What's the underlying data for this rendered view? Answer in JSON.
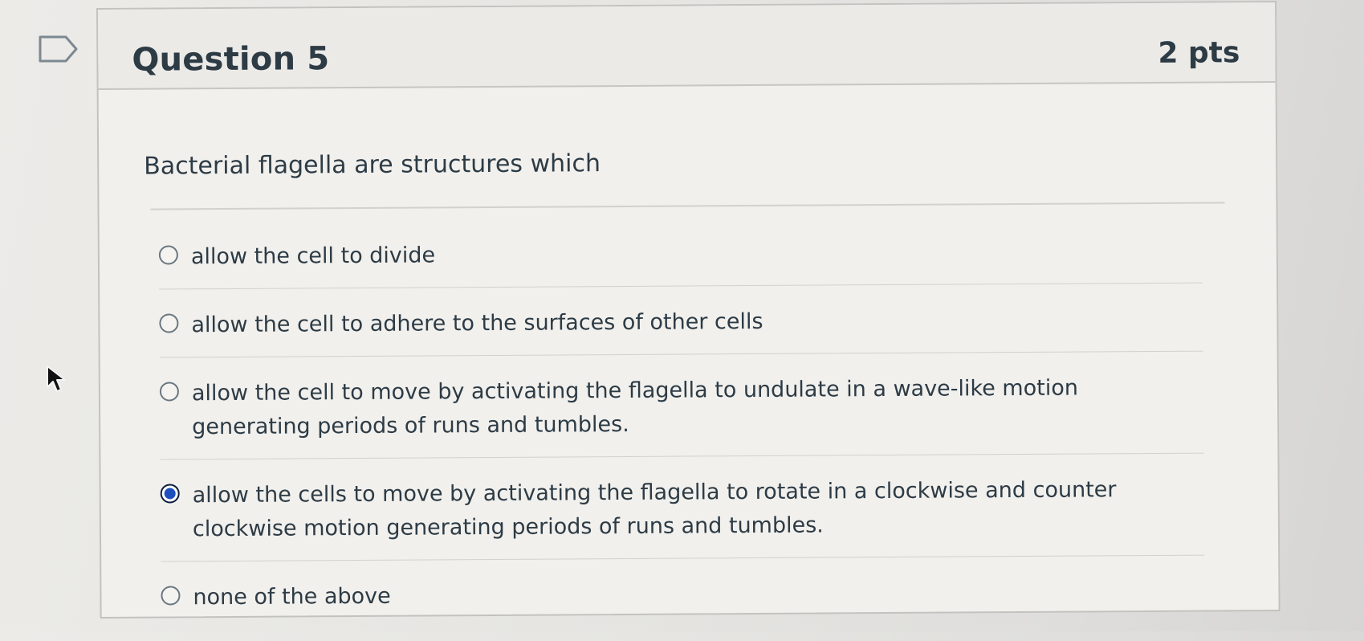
{
  "question": {
    "title": "Question 5",
    "points": "2 pts",
    "text": "Bacterial flagella are structures which"
  },
  "answers": [
    {
      "label": "allow the cell to divide",
      "selected": false
    },
    {
      "label": "allow the cell to adhere to the surfaces of other cells",
      "selected": false
    },
    {
      "label": "allow the cell to move by activating the flagella to undulate in a wave-like motion generating periods of runs and tumbles.",
      "selected": false
    },
    {
      "label": "allow the cells to move by activating the flagella to rotate in a clockwise and counter clockwise motion generating periods of runs and tumbles.",
      "selected": true
    },
    {
      "label": "none of the above",
      "selected": false
    }
  ],
  "icons": {
    "flag": "bookmark-flag-icon",
    "cursor": "mouse-pointer-icon",
    "radio_selected_color": "#1d4fbf"
  }
}
